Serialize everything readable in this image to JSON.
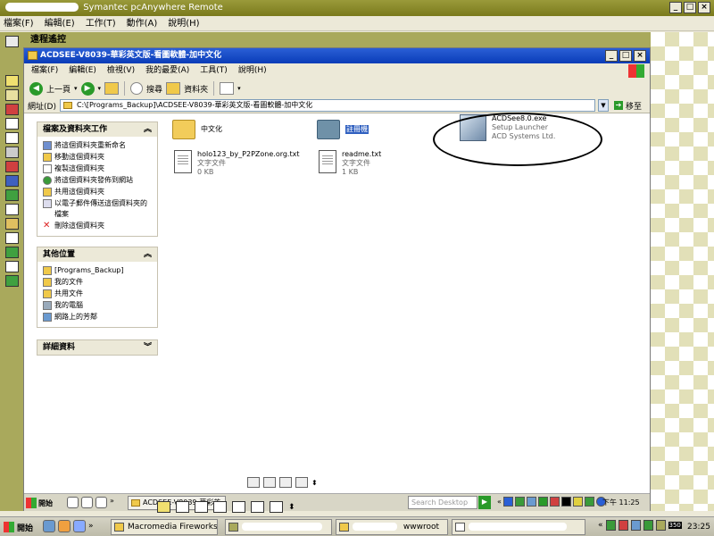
{
  "outer_window": {
    "title": "Symantec pcAnywhere Remote",
    "menu": [
      "檔案(F)",
      "編輯(E)",
      "工作(T)",
      "動作(A)",
      "說明(H)"
    ],
    "remote_label": "遠程遙控",
    "btn_min": "_",
    "btn_max": "□",
    "btn_close": "×"
  },
  "explorer": {
    "title": "ACDSEE-V8039-華彩英文版-看圖軟體-加中文化",
    "menu": [
      "檔案(F)",
      "編輯(E)",
      "檢視(V)",
      "我的最愛(A)",
      "工具(T)",
      "說明(H)"
    ],
    "toolbar": {
      "back_label": "上一頁",
      "search_label": "搜尋",
      "folders_label": "資料夾"
    },
    "address_label": "網址(D)",
    "address_value": "C:\\[Programs_Backup]\\ACDSEE-V8039-華彩英文版-看圖軟體-加中文化",
    "go_label": "移至",
    "file_tasks": {
      "title": "檔案及資料夾工作",
      "items": [
        "將這個資料夾重新命名",
        "移動這個資料夾",
        "複製這個資料夾",
        "將這個資料夾發佈到網站",
        "共用這個資料夾",
        "以電子郵件傳送這個資料夾的檔案",
        "刪除這個資料夾"
      ]
    },
    "other_places": {
      "title": "其他位置",
      "items": [
        "[Programs_Backup]",
        "我的文件",
        "共用文件",
        "我的電腦",
        "網路上的芳鄰"
      ]
    },
    "details": {
      "title": "詳細資料"
    },
    "files": [
      {
        "name": "中文化",
        "type": "",
        "size": ""
      },
      {
        "name": "註冊機",
        "type": "",
        "size": ""
      },
      {
        "name": "ACDSee8.0.exe",
        "type": "Setup Launcher",
        "size": "ACD Systems Ltd."
      },
      {
        "name": "holo123_by_P2PZone.org.txt",
        "type": "文字文件",
        "size": "0 KB"
      },
      {
        "name": "readme.txt",
        "type": "文字文件",
        "size": "1 KB"
      }
    ]
  },
  "inner_taskbar": {
    "start_label": "開始",
    "task_label": "ACDSEE-V8039-華彩英",
    "search_placeholder": "Search Desktop",
    "clock": "下午 11:25"
  },
  "outer_taskbar": {
    "start_label": "開始",
    "tasks": [
      "Macromedia Fireworks M...",
      "",
      "wwwroot",
      ""
    ],
    "tray_badge": "350",
    "clock": "23:25"
  }
}
